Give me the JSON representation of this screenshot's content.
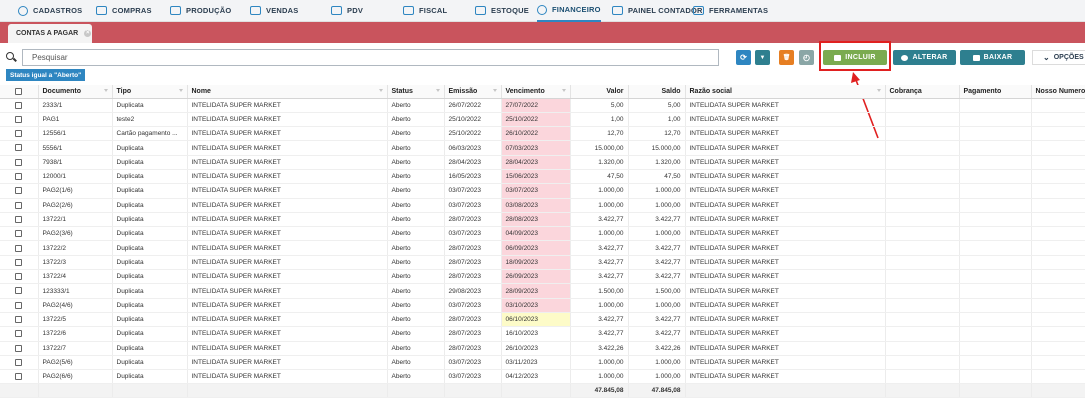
{
  "menu": [
    {
      "label": "CADASTROS",
      "icon": "circle-icon"
    },
    {
      "label": "COMPRAS",
      "icon": "cart-icon"
    },
    {
      "label": "PRODUÇÃO",
      "icon": "factory-icon"
    },
    {
      "label": "VENDAS",
      "icon": "tag-icon"
    },
    {
      "label": "PDV",
      "icon": "register-icon"
    },
    {
      "label": "FISCAL",
      "icon": "document-icon"
    },
    {
      "label": "ESTOQUE",
      "icon": "box-icon"
    },
    {
      "label": "FINANCEIRO",
      "icon": "dollar-icon",
      "active": true
    },
    {
      "label": "PAINEL CONTADOR",
      "icon": "calculator-icon"
    },
    {
      "label": "FERRAMENTAS",
      "icon": "tools-icon"
    }
  ],
  "tab": {
    "label": "CONTAS A PAGAR",
    "close_glyph": "×"
  },
  "search": {
    "placeholder": "Pesquisar",
    "value": ""
  },
  "toolbar": {
    "refresh_glyph": "⟳",
    "filter_glyph": "▼",
    "delete_glyph": "🗑",
    "clock_glyph": "◴",
    "incluir_label": "INCLUIR",
    "alterar_label": "ALTERAR",
    "baixar_label": "BAIXAR",
    "opcoes_label": "OPÇÕES",
    "opcoes_glyph": "⌄"
  },
  "colors": {
    "accent": "#2e86c1",
    "tabstrip": "#c9545d",
    "incluir": "#7aab4f",
    "alterar": "#2e7f8f",
    "baixar": "#2e7f8f",
    "refresh": "#2e86c1",
    "filter": "#2e7f8f",
    "delete": "#e67e22",
    "clock": "#8aa6a6",
    "highlight": "#e02020",
    "overdue": "#fbd6dc",
    "due_today": "#fdfbc8"
  },
  "filter": {
    "label": "Status igual a \"Aberto\""
  },
  "table": {
    "columns": [
      "Documento",
      "Tipo",
      "Nome",
      "Status",
      "Emissão",
      "Vencimento",
      "Valor",
      "Saldo",
      "Razão social",
      "Cobrança",
      "Pagamento",
      "Nosso Numero"
    ],
    "rows": [
      {
        "documento": "2333/1",
        "tipo": "Duplicata",
        "nome": "INTELIDATA SUPER MARKET",
        "status": "Aberto",
        "emissao": "26/07/2022",
        "vencimento": "27/07/2022",
        "valor": "5,00",
        "saldo": "5,00",
        "razao": "INTELIDATA SUPER MARKET",
        "cobranca": "",
        "pagamento": "",
        "nosso_numero": "",
        "venc_state": "overdue"
      },
      {
        "documento": "PAG1",
        "tipo": "teste2",
        "nome": "INTELIDATA SUPER MARKET",
        "status": "Aberto",
        "emissao": "25/10/2022",
        "vencimento": "25/10/2022",
        "valor": "1,00",
        "saldo": "1,00",
        "razao": "INTELIDATA SUPER MARKET",
        "cobranca": "",
        "pagamento": "",
        "nosso_numero": "",
        "venc_state": "overdue"
      },
      {
        "documento": "12556/1",
        "tipo": "Cartão pagamento ...",
        "nome": "INTELIDATA SUPER MARKET",
        "status": "Aberto",
        "emissao": "25/10/2022",
        "vencimento": "26/10/2022",
        "valor": "12,70",
        "saldo": "12,70",
        "razao": "INTELIDATA SUPER MARKET",
        "cobranca": "",
        "pagamento": "",
        "nosso_numero": "",
        "venc_state": "overdue"
      },
      {
        "documento": "5556/1",
        "tipo": "Duplicata",
        "nome": "INTELIDATA SUPER MARKET",
        "status": "Aberto",
        "emissao": "06/03/2023",
        "vencimento": "07/03/2023",
        "valor": "15.000,00",
        "saldo": "15.000,00",
        "razao": "INTELIDATA SUPER MARKET",
        "cobranca": "",
        "pagamento": "",
        "nosso_numero": "",
        "venc_state": "overdue"
      },
      {
        "documento": "7938/1",
        "tipo": "Duplicata",
        "nome": "INTELIDATA SUPER MARKET",
        "status": "Aberto",
        "emissao": "28/04/2023",
        "vencimento": "28/04/2023",
        "valor": "1.320,00",
        "saldo": "1.320,00",
        "razao": "INTELIDATA SUPER MARKET",
        "cobranca": "",
        "pagamento": "",
        "nosso_numero": "",
        "venc_state": "overdue"
      },
      {
        "documento": "12000/1",
        "tipo": "Duplicata",
        "nome": "INTELIDATA SUPER MARKET",
        "status": "Aberto",
        "emissao": "16/05/2023",
        "vencimento": "15/06/2023",
        "valor": "47,50",
        "saldo": "47,50",
        "razao": "INTELIDATA SUPER MARKET",
        "cobranca": "",
        "pagamento": "",
        "nosso_numero": "",
        "venc_state": "overdue"
      },
      {
        "documento": "PAG2(1/6)",
        "tipo": "Duplicata",
        "nome": "INTELIDATA SUPER MARKET",
        "status": "Aberto",
        "emissao": "03/07/2023",
        "vencimento": "03/07/2023",
        "valor": "1.000,00",
        "saldo": "1.000,00",
        "razao": "INTELIDATA SUPER MARKET",
        "cobranca": "",
        "pagamento": "",
        "nosso_numero": "",
        "venc_state": "overdue"
      },
      {
        "documento": "PAG2(2/6)",
        "tipo": "Duplicata",
        "nome": "INTELIDATA SUPER MARKET",
        "status": "Aberto",
        "emissao": "03/07/2023",
        "vencimento": "03/08/2023",
        "valor": "1.000,00",
        "saldo": "1.000,00",
        "razao": "INTELIDATA SUPER MARKET",
        "cobranca": "",
        "pagamento": "",
        "nosso_numero": "",
        "venc_state": "overdue"
      },
      {
        "documento": "13722/1",
        "tipo": "Duplicata",
        "nome": "INTELIDATA SUPER MARKET",
        "status": "Aberto",
        "emissao": "28/07/2023",
        "vencimento": "28/08/2023",
        "valor": "3.422,77",
        "saldo": "3.422,77",
        "razao": "INTELIDATA SUPER MARKET",
        "cobranca": "",
        "pagamento": "",
        "nosso_numero": "",
        "venc_state": "overdue"
      },
      {
        "documento": "PAG2(3/6)",
        "tipo": "Duplicata",
        "nome": "INTELIDATA SUPER MARKET",
        "status": "Aberto",
        "emissao": "03/07/2023",
        "vencimento": "04/09/2023",
        "valor": "1.000,00",
        "saldo": "1.000,00",
        "razao": "INTELIDATA SUPER MARKET",
        "cobranca": "",
        "pagamento": "",
        "nosso_numero": "",
        "venc_state": "overdue"
      },
      {
        "documento": "13722/2",
        "tipo": "Duplicata",
        "nome": "INTELIDATA SUPER MARKET",
        "status": "Aberto",
        "emissao": "28/07/2023",
        "vencimento": "06/09/2023",
        "valor": "3.422,77",
        "saldo": "3.422,77",
        "razao": "INTELIDATA SUPER MARKET",
        "cobranca": "",
        "pagamento": "",
        "nosso_numero": "",
        "venc_state": "overdue"
      },
      {
        "documento": "13722/3",
        "tipo": "Duplicata",
        "nome": "INTELIDATA SUPER MARKET",
        "status": "Aberto",
        "emissao": "28/07/2023",
        "vencimento": "18/09/2023",
        "valor": "3.422,77",
        "saldo": "3.422,77",
        "razao": "INTELIDATA SUPER MARKET",
        "cobranca": "",
        "pagamento": "",
        "nosso_numero": "",
        "venc_state": "overdue"
      },
      {
        "documento": "13722/4",
        "tipo": "Duplicata",
        "nome": "INTELIDATA SUPER MARKET",
        "status": "Aberto",
        "emissao": "28/07/2023",
        "vencimento": "26/09/2023",
        "valor": "3.422,77",
        "saldo": "3.422,77",
        "razao": "INTELIDATA SUPER MARKET",
        "cobranca": "",
        "pagamento": "",
        "nosso_numero": "",
        "venc_state": "overdue"
      },
      {
        "documento": "123333/1",
        "tipo": "Duplicata",
        "nome": "INTELIDATA SUPER MARKET",
        "status": "Aberto",
        "emissao": "29/08/2023",
        "vencimento": "28/09/2023",
        "valor": "1.500,00",
        "saldo": "1.500,00",
        "razao": "INTELIDATA SUPER MARKET",
        "cobranca": "",
        "pagamento": "",
        "nosso_numero": "",
        "venc_state": "overdue"
      },
      {
        "documento": "PAG2(4/6)",
        "tipo": "Duplicata",
        "nome": "INTELIDATA SUPER MARKET",
        "status": "Aberto",
        "emissao": "03/07/2023",
        "vencimento": "03/10/2023",
        "valor": "1.000,00",
        "saldo": "1.000,00",
        "razao": "INTELIDATA SUPER MARKET",
        "cobranca": "",
        "pagamento": "",
        "nosso_numero": "",
        "venc_state": "overdue"
      },
      {
        "documento": "13722/5",
        "tipo": "Duplicata",
        "nome": "INTELIDATA SUPER MARKET",
        "status": "Aberto",
        "emissao": "28/07/2023",
        "vencimento": "06/10/2023",
        "valor": "3.422,77",
        "saldo": "3.422,77",
        "razao": "INTELIDATA SUPER MARKET",
        "cobranca": "",
        "pagamento": "",
        "nosso_numero": "",
        "venc_state": "due_today"
      },
      {
        "documento": "13722/6",
        "tipo": "Duplicata",
        "nome": "INTELIDATA SUPER MARKET",
        "status": "Aberto",
        "emissao": "28/07/2023",
        "vencimento": "16/10/2023",
        "valor": "3.422,77",
        "saldo": "3.422,77",
        "razao": "INTELIDATA SUPER MARKET",
        "cobranca": "",
        "pagamento": "",
        "nosso_numero": "",
        "venc_state": "normal"
      },
      {
        "documento": "13722/7",
        "tipo": "Duplicata",
        "nome": "INTELIDATA SUPER MARKET",
        "status": "Aberto",
        "emissao": "28/07/2023",
        "vencimento": "26/10/2023",
        "valor": "3.422,26",
        "saldo": "3.422,26",
        "razao": "INTELIDATA SUPER MARKET",
        "cobranca": "",
        "pagamento": "",
        "nosso_numero": "",
        "venc_state": "normal"
      },
      {
        "documento": "PAG2(5/6)",
        "tipo": "Duplicata",
        "nome": "INTELIDATA SUPER MARKET",
        "status": "Aberto",
        "emissao": "03/07/2023",
        "vencimento": "03/11/2023",
        "valor": "1.000,00",
        "saldo": "1.000,00",
        "razao": "INTELIDATA SUPER MARKET",
        "cobranca": "",
        "pagamento": "",
        "nosso_numero": "",
        "venc_state": "normal"
      },
      {
        "documento": "PAG2(6/6)",
        "tipo": "Duplicata",
        "nome": "INTELIDATA SUPER MARKET",
        "status": "Aberto",
        "emissao": "03/07/2023",
        "vencimento": "04/12/2023",
        "valor": "1.000,00",
        "saldo": "1.000,00",
        "razao": "INTELIDATA SUPER MARKET",
        "cobranca": "",
        "pagamento": "",
        "nosso_numero": "",
        "venc_state": "normal"
      }
    ],
    "totals": {
      "valor": "47.845,08",
      "saldo": "47.845,08"
    }
  }
}
